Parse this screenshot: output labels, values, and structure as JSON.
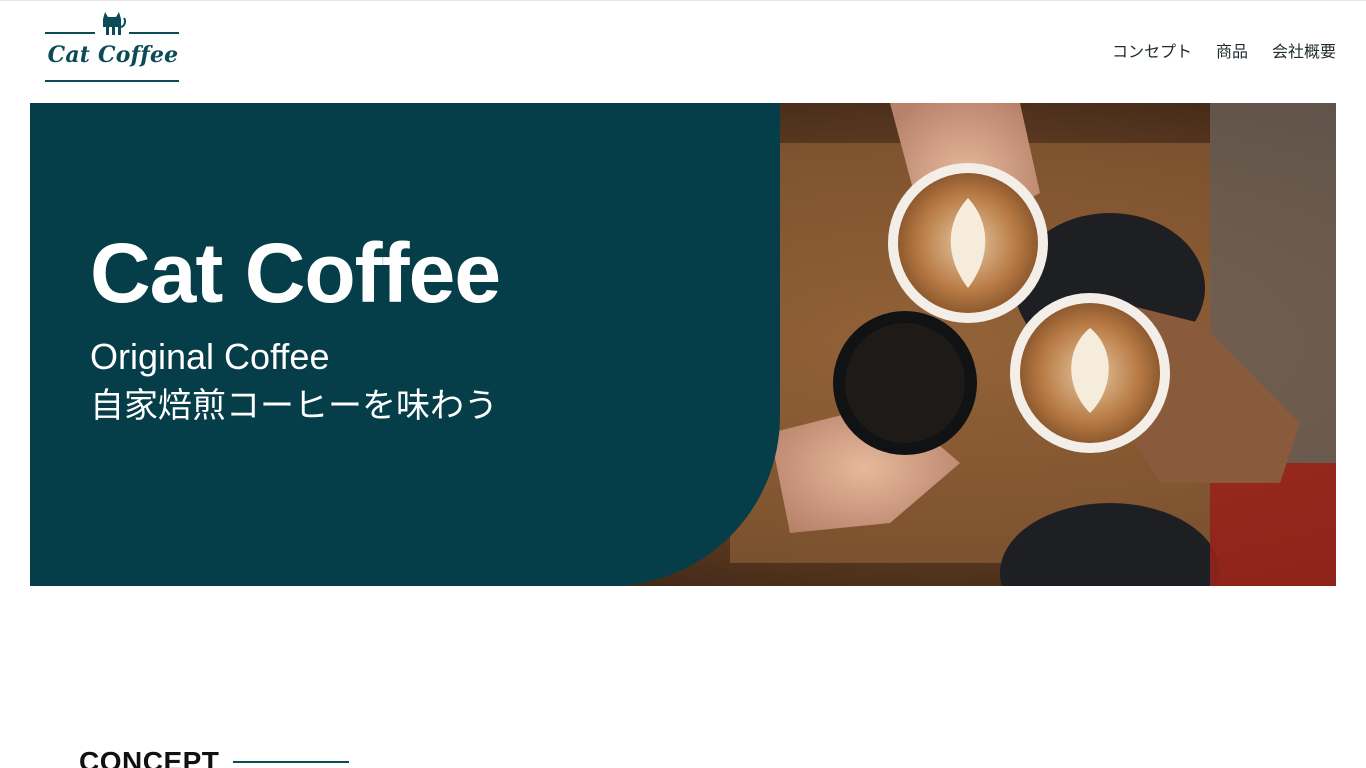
{
  "header": {
    "logo_text": "Cat Coffee",
    "nav": [
      {
        "label": "コンセプト"
      },
      {
        "label": "商品"
      },
      {
        "label": "会社概要"
      }
    ]
  },
  "hero": {
    "title": "Cat Coffee",
    "subtitle_en": "Original Coffee",
    "subtitle_ja": "自家焙煎コーヒーを味わう",
    "photo_icon": "coffee-cups-cheers-photo"
  },
  "concept": {
    "title": "CONCEPT"
  },
  "colors": {
    "brand_teal": "#053d49",
    "logo_teal": "#0a4b55",
    "text_dark": "#1d2a2c",
    "white": "#ffffff"
  }
}
